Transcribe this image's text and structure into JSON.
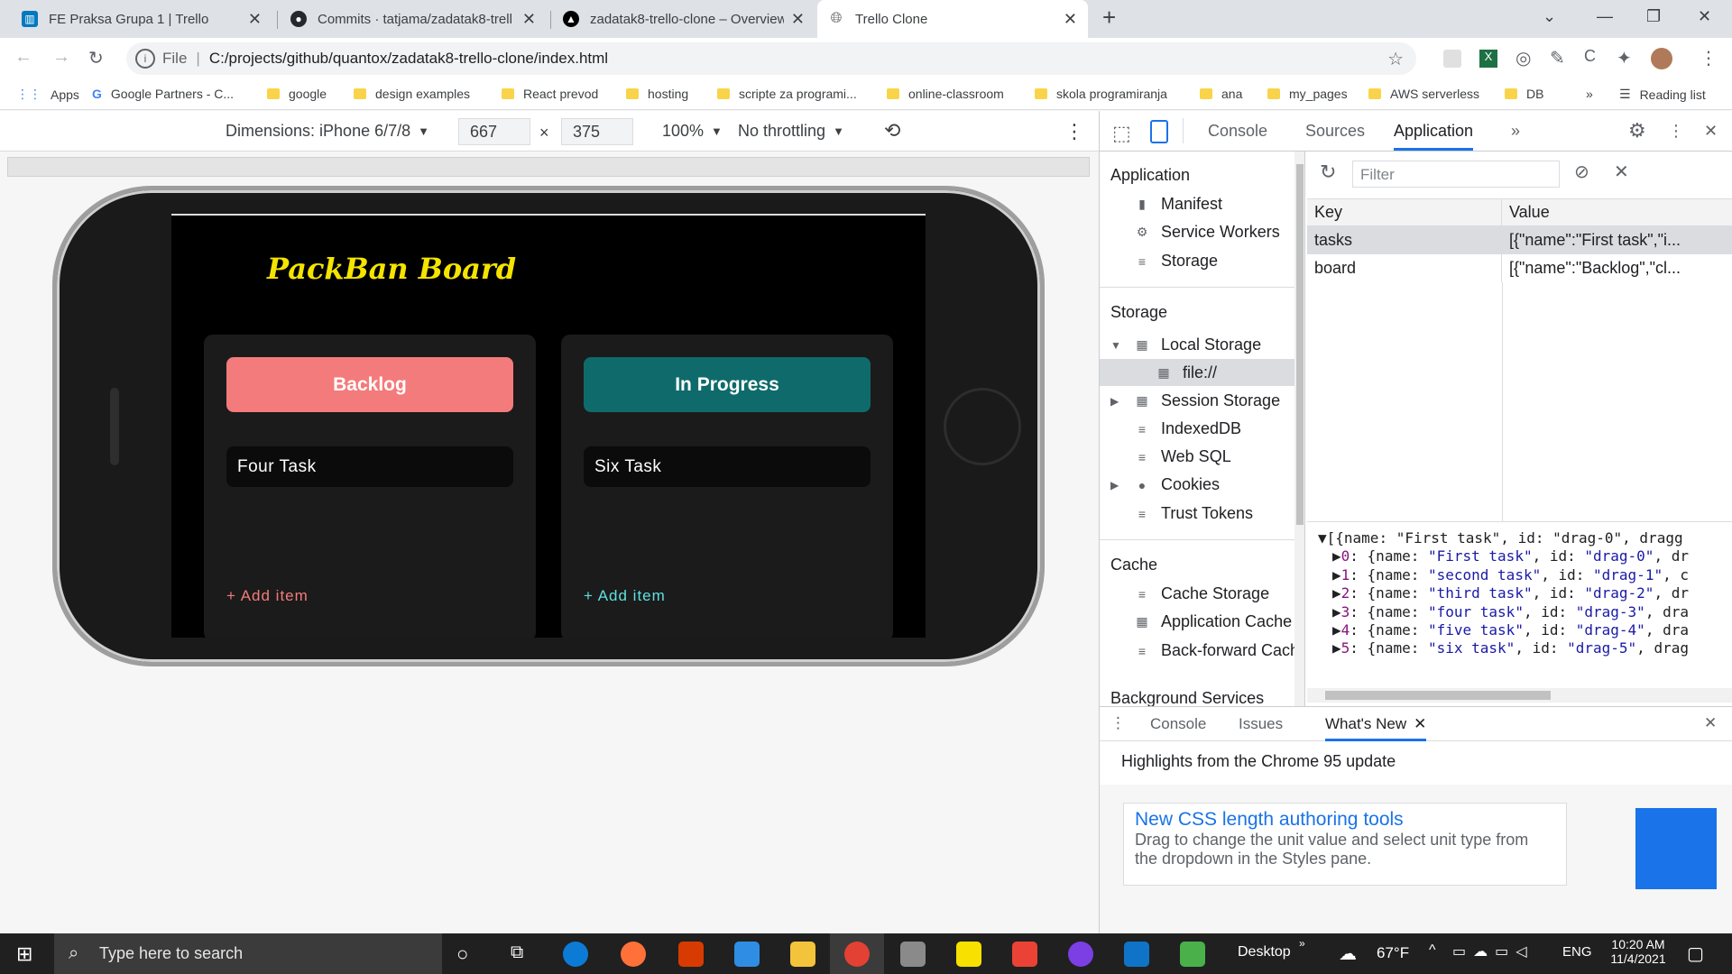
{
  "browser": {
    "tabs": [
      {
        "title": "FE Praksa Grupa 1 | Trello",
        "icon": "trello-icon",
        "color": "#0079bf"
      },
      {
        "title": "Commits · tatjama/zadatak8-trell",
        "icon": "github-icon",
        "color": "#24292e"
      },
      {
        "title": "zadatak8-trello-clone – Overview",
        "icon": "vercel-icon",
        "color": "#000000"
      },
      {
        "title": "Trello Clone",
        "icon": "globe-icon",
        "color": "#5f6368"
      }
    ],
    "url_prefix": "File",
    "url": "C:/projects/github/quantox/zadatak8-trello-clone/index.html",
    "apps_label": "Apps",
    "bookmarks": [
      "Google Partners - C...",
      "google",
      "design examples",
      "React prevod",
      "hosting",
      "scripte za programi...",
      "online-classroom",
      "skola programiranja",
      "ana",
      "my_pages",
      "AWS serverless",
      "DB"
    ],
    "more_bookmarks": "»",
    "reading_list": "Reading list"
  },
  "device_toolbar": {
    "dimensions_label": "Dimensions: iPhone 6/7/8",
    "width": "667",
    "height": "375",
    "zoom": "100%",
    "throttling": "No throttling"
  },
  "app": {
    "title": "PackBan Board",
    "columns": [
      {
        "title": "Backlog",
        "color": "#f47b7b",
        "task": "Four Task",
        "add_label": "+ Add item",
        "add_color": "#f47b7b"
      },
      {
        "title": "In Progress",
        "color": "#0f6b6b",
        "task": "Six Task",
        "add_label": "+ Add item",
        "add_color": "#5fe0e0"
      }
    ]
  },
  "devtools": {
    "tabs": [
      "Console",
      "Sources",
      "Application"
    ],
    "active_tab": "Application",
    "more": "»",
    "sidebar": {
      "application_header": "Application",
      "application_items": [
        {
          "label": "Manifest",
          "icon": "document-icon"
        },
        {
          "label": "Service Workers",
          "icon": "gear-icon"
        },
        {
          "label": "Storage",
          "icon": "database-icon"
        }
      ],
      "storage_header": "Storage",
      "local_storage": "Local Storage",
      "local_storage_child": "file://",
      "storage_items": [
        "Session Storage",
        "IndexedDB",
        "Web SQL",
        "Cookies",
        "Trust Tokens"
      ],
      "cache_header": "Cache",
      "cache_items": [
        "Cache Storage",
        "Application Cache",
        "Back-forward Cache"
      ],
      "background_header": "Background Services"
    },
    "filter_placeholder": "Filter",
    "table": {
      "key_header": "Key",
      "value_header": "Value",
      "rows": [
        {
          "key": "tasks",
          "value": "[{\"name\":\"First task\",\"i..."
        },
        {
          "key": "board",
          "value": "[{\"name\":\"Backlog\",\"cl..."
        }
      ]
    },
    "preview": {
      "summary": "[{name: \"First task\", id: \"drag-0\", dragg",
      "items": [
        {
          "idx": "0",
          "name": "\"First task\"",
          "id": "\"drag-0\"",
          "tail": "dr"
        },
        {
          "idx": "1",
          "name": "\"second task\"",
          "id": "\"drag-1\"",
          "tail": "c"
        },
        {
          "idx": "2",
          "name": "\"third task\"",
          "id": "\"drag-2\"",
          "tail": "dr"
        },
        {
          "idx": "3",
          "name": "\"four task\"",
          "id": "\"drag-3\"",
          "tail": "dra"
        },
        {
          "idx": "4",
          "name": "\"five task\"",
          "id": "\"drag-4\"",
          "tail": "dra"
        },
        {
          "idx": "5",
          "name": "\"six task\"",
          "id": "\"drag-5\"",
          "tail": "drag"
        }
      ]
    },
    "drawer": {
      "tabs": [
        "Console",
        "Issues",
        "What's New"
      ],
      "active_tab": "What's New",
      "headline": "Highlights from the Chrome 95 update",
      "card_title": "New CSS length authoring tools",
      "card_text": "Drag to change the unit value and select unit type from the dropdown in the Styles pane."
    }
  },
  "taskbar": {
    "search_placeholder": "Type here to search",
    "desktop_label": "Desktop",
    "weather": "67°F",
    "language": "ENG",
    "time": "10:20 AM",
    "date": "11/4/2021"
  }
}
